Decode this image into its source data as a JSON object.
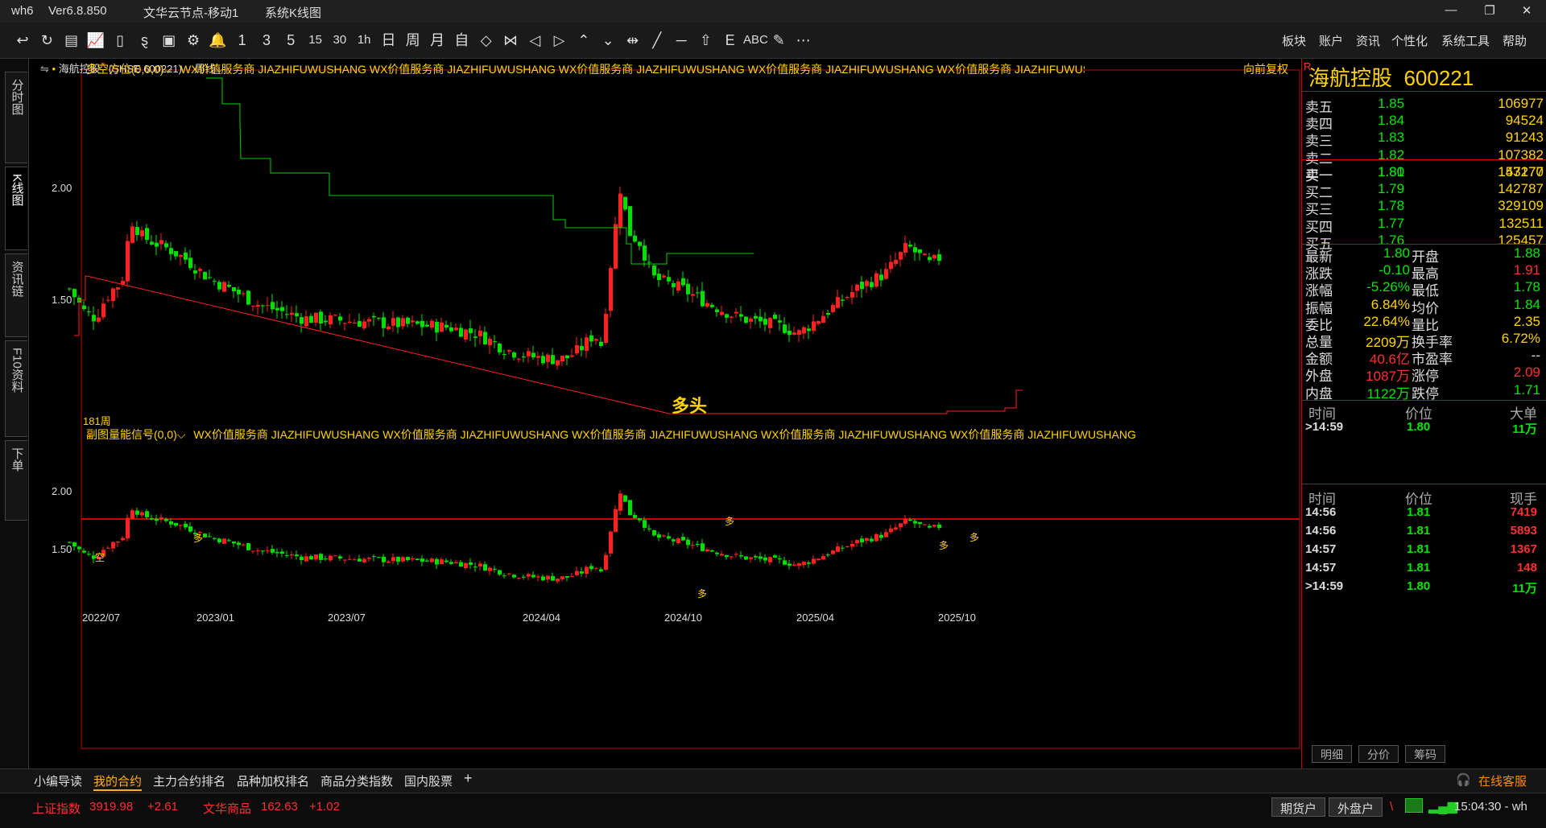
{
  "window": {
    "app": "wh6",
    "version": "Ver6.8.850",
    "node": "文华云节点-移动1",
    "page": "系统K线图",
    "controls": [
      "—",
      "❐",
      "✕"
    ]
  },
  "toolbar": {
    "buttons": [
      "↩",
      "↻",
      "▤",
      "📈",
      "▯",
      "ȿ",
      "▣",
      "⚙",
      "🔔",
      "1",
      "3",
      "5",
      "15",
      "30",
      "1h",
      "日",
      "周",
      "月",
      "自",
      "◇",
      "⋈",
      "◁",
      "▷",
      "⌃",
      "⌄",
      "⇹",
      "╱",
      "─",
      "⇧",
      "E",
      "ABC",
      "✎",
      "⋯"
    ],
    "menus": [
      "板块",
      "账户",
      "资讯",
      "个性化",
      "系统工具",
      "帮助"
    ]
  },
  "sidetabs": [
    "分时图",
    "K线图",
    "资讯链",
    "F10资料",
    "下单"
  ],
  "chart_header": {
    "name": "海航控股",
    "flag": "R",
    "code": "(SHSE 600221)",
    "period": "周线"
  },
  "main_panel": {
    "indicator": "多空方位(0,0,0)",
    "ad_text": "WX价值服务商  JIAZHIFUWUSHANG  WX价值服务商  JIAZHIFUWUSHANG  WX价值服务商  JIAZHIFUWUSHANG  WX价值服务商  JIAZHIFUWUSHANG  WX价值服务商  JIAZHIFUWUSHANG  WX价值服务商  JIAZHIFUWUSHANG",
    "right_label": "向前复权",
    "bars_label": "181周",
    "signal": "多头",
    "y_ticks": [
      "2.00",
      "1.50"
    ]
  },
  "sub_panel": {
    "indicator": "副图量能信号(0,0)",
    "ad_text": "WX价值服务商  JIAZHIFUWUSHANG  WX价值服务商  JIAZHIFUWUSHANG  WX价值服务商  JIAZHIFUWUSHANG  WX价值服务商  JIAZHIFUWUSHANG  WX价值服务商  JIAZHIFUWUSHANG",
    "y_ticks": [
      "2.00",
      "1.50"
    ],
    "marks": [
      "空",
      "多"
    ]
  },
  "x_axis": [
    "2022/07",
    "2023/01",
    "2023/07",
    "2024/04",
    "2024/10",
    "2025/04",
    "2025/10"
  ],
  "quote": {
    "flag": "R",
    "name": "海航控股",
    "code": "600221",
    "asks": [
      {
        "label": "卖五",
        "price": "1.85",
        "vol": "106977"
      },
      {
        "label": "卖四",
        "price": "1.84",
        "vol": "94524"
      },
      {
        "label": "卖三",
        "price": "1.83",
        "vol": "91243"
      },
      {
        "label": "卖二",
        "price": "1.82",
        "vol": "107382"
      },
      {
        "label": "卖一",
        "price": "1.81",
        "vol": "153177"
      }
    ],
    "bids": [
      {
        "label": "买一",
        "price": "1.80",
        "vol": "147270"
      },
      {
        "label": "买二",
        "price": "1.79",
        "vol": "142787"
      },
      {
        "label": "买三",
        "price": "1.78",
        "vol": "329109"
      },
      {
        "label": "买四",
        "price": "1.77",
        "vol": "132511"
      },
      {
        "label": "买五",
        "price": "1.76",
        "vol": "125457"
      }
    ],
    "stats": [
      [
        "最新",
        "1.80",
        "g",
        "开盘",
        "1.88",
        "g"
      ],
      [
        "涨跌",
        "-0.10",
        "g",
        "最高",
        "1.91",
        "r"
      ],
      [
        "涨幅",
        "-5.26%",
        "g",
        "最低",
        "1.78",
        "g"
      ],
      [
        "振幅",
        "6.84%",
        "y",
        "均价",
        "1.84",
        "g"
      ],
      [
        "委比",
        "22.64%",
        "y",
        "量比",
        "2.35",
        "y"
      ],
      [
        "总量",
        "2209万",
        "y",
        "换手率",
        "6.72%",
        "y"
      ],
      [
        "金额",
        "40.6亿",
        "r",
        "市盈率",
        "--",
        "w"
      ],
      [
        "外盘",
        "1087万",
        "r",
        "涨停",
        "2.09",
        "r"
      ],
      [
        "内盘",
        "1122万",
        "g",
        "跌停",
        "1.71",
        "g"
      ]
    ],
    "big": {
      "headers": [
        "时间",
        "价位",
        "大单"
      ],
      "rows": [
        [
          ">14:59",
          "1.80",
          "11万"
        ]
      ]
    },
    "ticks": {
      "headers": [
        "时间",
        "价位",
        "现手"
      ],
      "rows": [
        [
          "14:56",
          "1.81",
          "7419",
          "r"
        ],
        [
          "14:56",
          "1.81",
          "5893",
          "r"
        ],
        [
          "14:57",
          "1.81",
          "1367",
          "r"
        ],
        [
          "14:57",
          "1.81",
          "148",
          "r"
        ],
        [
          ">14:59",
          "1.80",
          "11万",
          "g"
        ]
      ]
    },
    "tabs": [
      "明细",
      "分价",
      "筹码"
    ]
  },
  "bottom_tabs": [
    "小编导读",
    "我的合约",
    "主力合约排名",
    "品种加权排名",
    "商品分类指数",
    "国内股票",
    "+"
  ],
  "status": {
    "index1_name": "上证指数",
    "index1_val": "3919.98",
    "index1_chg": "+2.61",
    "index2_name": "文华商品",
    "index2_val": "162.63",
    "index2_chg": "+1.02",
    "btn1": "期货户",
    "btn2": "外盘户",
    "time": "15:04:30 - wh",
    "service": "在线客服"
  },
  "colors": {
    "up": "#ff3030",
    "down": "#00e600",
    "accent": "#ffd400",
    "line": "#00d000"
  }
}
